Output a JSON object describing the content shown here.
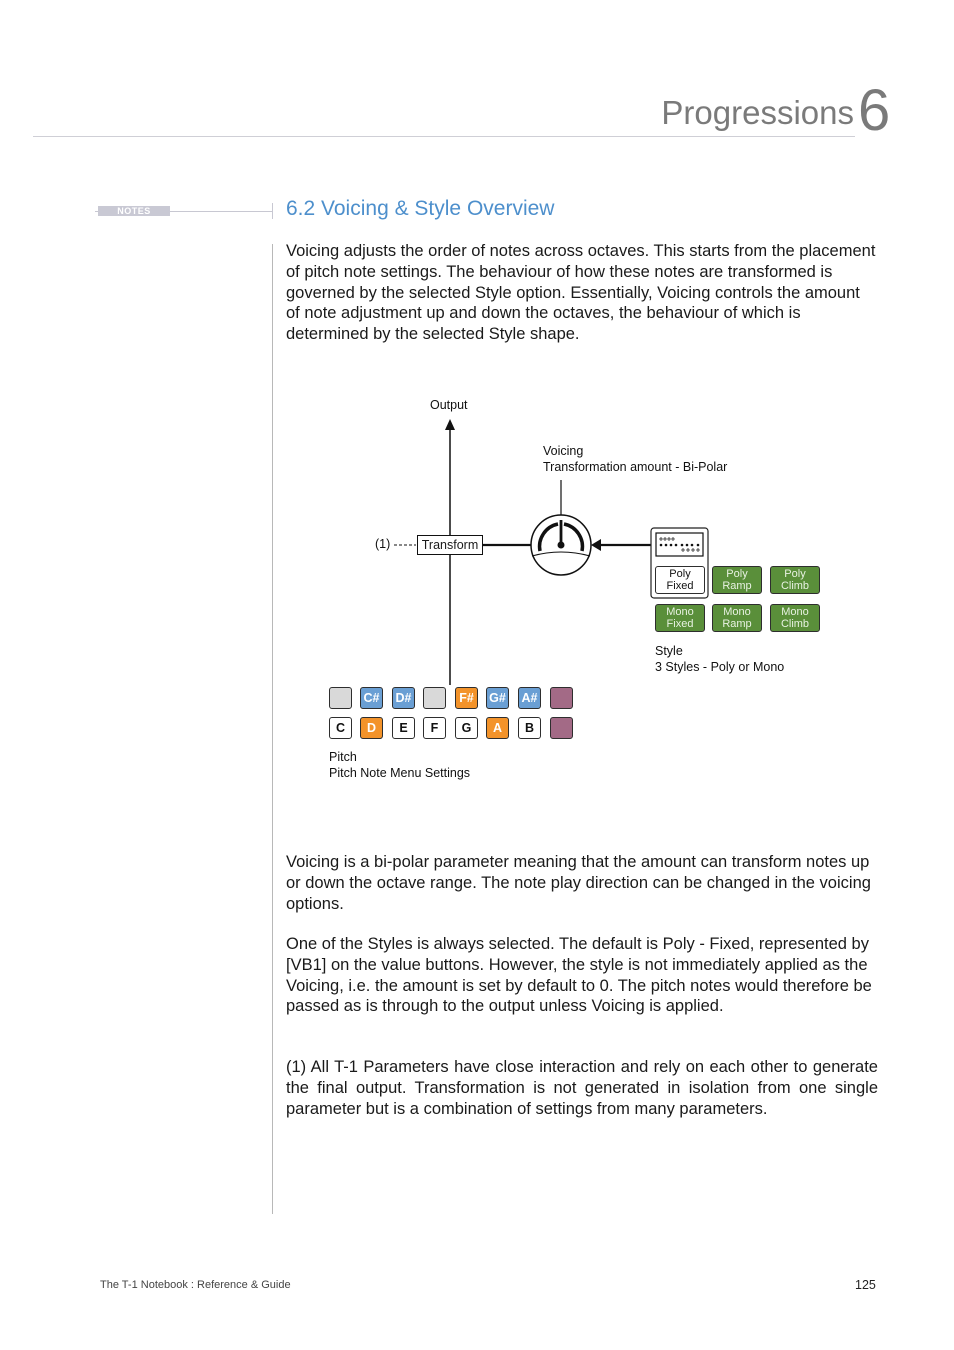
{
  "header": {
    "chapter_title": "Progressions",
    "chapter_number": "6"
  },
  "sidebar": {
    "notes_label": "NOTES"
  },
  "section": {
    "title": "6.2 Voicing & Style Overview",
    "intro": "Voicing adjusts the order of notes across octaves. This starts from the placement of pitch note settings. The behaviour of how these notes are transformed is governed by the selected Style option. Essentially, Voicing controls the amount of note adjustment up and down the octaves, the behaviour of which is determined by the selected Style shape."
  },
  "diagram": {
    "output_label": "Output",
    "voicing_label": "Voicing",
    "voicing_sublabel": "Transformation amount - Bi-Polar",
    "transform_label": "Transform",
    "footnote_marker": "(1)",
    "style_label": "Style",
    "style_sublabel": "3 Styles - Poly or Mono",
    "pitch_label": "Pitch",
    "pitch_sublabel": "Pitch Note Menu Settings",
    "style_buttons": [
      {
        "line1": "Poly",
        "line2": "Fixed",
        "selected": true
      },
      {
        "line1": "Poly",
        "line2": "Ramp",
        "selected": false
      },
      {
        "line1": "Poly",
        "line2": "Climb",
        "selected": false
      },
      {
        "line1": "Mono",
        "line2": "Fixed",
        "selected": false
      },
      {
        "line1": "Mono",
        "line2": "Ramp",
        "selected": false
      },
      {
        "line1": "Mono",
        "line2": "Climb",
        "selected": false
      }
    ],
    "sharp_notes": [
      {
        "label": "",
        "state": "grey"
      },
      {
        "label": "C#",
        "state": "blue"
      },
      {
        "label": "D#",
        "state": "blue"
      },
      {
        "label": "",
        "state": "grey"
      },
      {
        "label": "F#",
        "state": "orange"
      },
      {
        "label": "G#",
        "state": "blue"
      },
      {
        "label": "A#",
        "state": "blue"
      },
      {
        "label": "",
        "state": "purple"
      }
    ],
    "natural_notes": [
      {
        "label": "C",
        "state": "white"
      },
      {
        "label": "D",
        "state": "orange"
      },
      {
        "label": "E",
        "state": "white"
      },
      {
        "label": "F",
        "state": "white"
      },
      {
        "label": "G",
        "state": "white"
      },
      {
        "label": "A",
        "state": "orange"
      },
      {
        "label": "B",
        "state": "white"
      },
      {
        "label": "",
        "state": "purple"
      }
    ]
  },
  "body": {
    "para1": "Voicing is a bi-polar parameter meaning that the amount can transform notes up or down the octave range. The note play direction can be changed in the voicing options.",
    "para2": "One of the Styles is always selected. The default is Poly - Fixed, represented by [VB1] on the value buttons. However, the style is not immediately applied as the Voicing, i.e. the amount is set by default to 0. The pitch notes would therefore be passed as is through to the output unless Voicing is applied.",
    "para3": "(1) All T-1 Parameters have close interaction and rely on each other to generate the final output. Transformation is not generated in isolation from one single parameter but is a combination of settings from many parameters."
  },
  "footer": {
    "book_title": "The T-1 Notebook : Reference & Guide",
    "page_number": "125"
  },
  "colors": {
    "accent_blue": "#4d8fcc",
    "style_green": "#5a8f3a",
    "note_blue": "#6a9fd4",
    "note_orange": "#f3932a",
    "note_purple": "#a36a86"
  }
}
